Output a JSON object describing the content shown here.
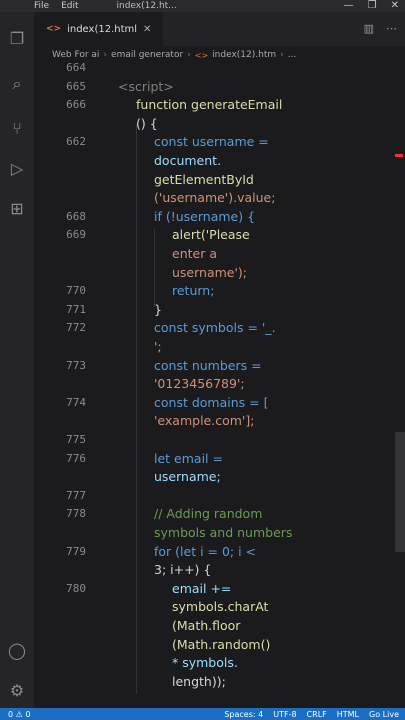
{
  "titlebar": {
    "menu": [
      "File",
      "Edit"
    ],
    "title": "index(12.ht..."
  },
  "tab": {
    "label": "index(12.html"
  },
  "breadcrumb": [
    "Web For ai",
    "email generator",
    "index(12).htm",
    "..."
  ],
  "lines": [
    {
      "n": "664",
      "t": ""
    },
    {
      "n": "665",
      "t": "<script>"
    },
    {
      "n": "666",
      "t": "function generateEmail"
    },
    {
      "n": "",
      "t": "() {"
    },
    {
      "n": "662",
      "t": "const username ="
    },
    {
      "n": "",
      "t": "document."
    },
    {
      "n": "",
      "t": "getElementById"
    },
    {
      "n": "",
      "t": "('username').value;"
    },
    {
      "n": "668",
      "t": "if (!username) {"
    },
    {
      "n": "669",
      "t": "alert('Please"
    },
    {
      "n": "",
      "t": "enter a"
    },
    {
      "n": "",
      "t": "username');"
    },
    {
      "n": "770",
      "t": "return;"
    },
    {
      "n": "771",
      "t": "}"
    },
    {
      "n": "772",
      "t": "const symbols = '_."
    },
    {
      "n": "",
      "t": "';"
    },
    {
      "n": "773",
      "t": "const numbers ="
    },
    {
      "n": "",
      "t": "'0123456789';"
    },
    {
      "n": "774",
      "t": "const domains = ["
    },
    {
      "n": "",
      "t": "'example.com'];"
    },
    {
      "n": "775",
      "t": ""
    },
    {
      "n": "776",
      "t": "let email ="
    },
    {
      "n": "",
      "t": "username;"
    },
    {
      "n": "777",
      "t": ""
    },
    {
      "n": "778",
      "t": "// Adding random"
    },
    {
      "n": "",
      "t": "symbols and numbers"
    },
    {
      "n": "779",
      "t": "for (let i = 0; i <"
    },
    {
      "n": "",
      "t": "3; i++) {"
    },
    {
      "n": "780",
      "t": "email +="
    },
    {
      "n": "",
      "t": "symbols.charAt"
    },
    {
      "n": "",
      "t": "(Math.floor"
    },
    {
      "n": "",
      "t": "(Math.random()"
    },
    {
      "n": "",
      "t": "* symbols."
    },
    {
      "n": "",
      "t": "length));"
    }
  ],
  "status": {
    "left": "0 ⚠ 0",
    "items": [
      "Spaces: 4",
      "UTF-8",
      "CRLF",
      "HTML",
      "Go Live"
    ]
  }
}
